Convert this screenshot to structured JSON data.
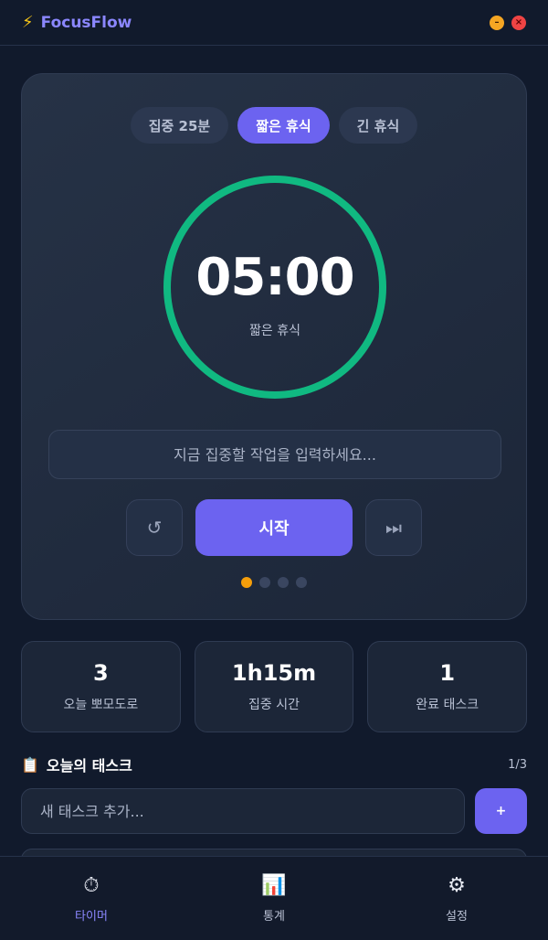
{
  "app": {
    "title": "FocusFlow"
  },
  "timer": {
    "modes": [
      {
        "label": "집중 25분"
      },
      {
        "label": "짧은 휴식"
      },
      {
        "label": "긴 휴식"
      }
    ],
    "active_mode": 1,
    "time": "05:00",
    "label": "짧은 휴식",
    "progress": 1.0,
    "ring_color": "#10b981",
    "task_placeholder": "지금 집중할 작업을 입력하세요...",
    "reset_icon": "↺",
    "start_label": "시작",
    "skip_icon": "⏭",
    "session_dots": 4,
    "active_dot": 0
  },
  "stats": [
    {
      "value": "3",
      "label": "오늘 뽀모도로"
    },
    {
      "value": "1h15m",
      "label": "집중 시간"
    },
    {
      "value": "1",
      "label": "완료 태스크"
    }
  ],
  "tasks": {
    "title": "오늘의 태스크",
    "count": "1/3",
    "new_placeholder": "새 태스크 추가...",
    "add_label": "+"
  },
  "nav": [
    {
      "icon": "⏱",
      "label": "타이머"
    },
    {
      "icon": "📊",
      "label": "통계"
    },
    {
      "icon": "⚙",
      "label": "설정"
    }
  ],
  "colors": {
    "accent": "#6c63f0",
    "ring": "#10b981",
    "dot_active": "#f59e0b"
  }
}
